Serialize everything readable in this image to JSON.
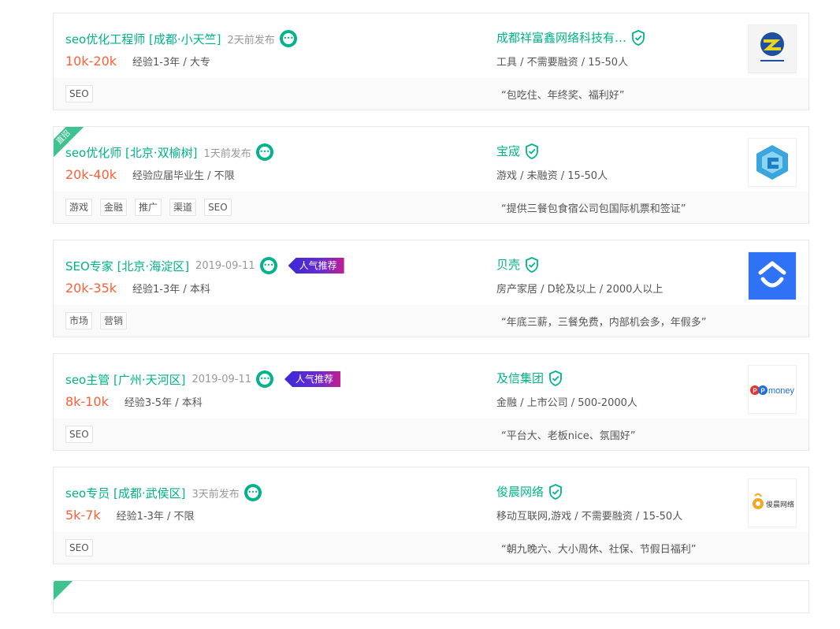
{
  "jobs": [
    {
      "position": "seo优化工程师 [成都·小天竺]",
      "published": "2天前发布",
      "salary": "10k-20k",
      "requirement": "经验1-3年 / 大专",
      "tags": [
        "SEO"
      ],
      "company": "成都祥富鑫网络科技有…",
      "industry": "工具 / 不需要融资 / 15-50人",
      "advantage": "“包吃住、年终奖、福利好”",
      "logo": "xiangfuxin-logo"
    },
    {
      "corner_flag": "直招",
      "position": "seo优化师 [北京·双榆树]",
      "published": "1天前发布",
      "salary": "20k-40k",
      "requirement": "经验应届毕业生 / 不限",
      "tags": [
        "游戏",
        "金融",
        "推广",
        "渠道",
        "SEO"
      ],
      "company": "宝宬",
      "industry": "游戏 / 未融资 / 15-50人",
      "advantage": "“提供三餐包食宿公司包国际机票和签证”",
      "logo": "baocheng-logo"
    },
    {
      "position": "SEO专家 [北京·海淀区]",
      "published": "2019-09-11",
      "hot_badge": "人气推荐",
      "salary": "20k-35k",
      "requirement": "经验1-3年 / 本科",
      "tags": [
        "市场",
        "营销"
      ],
      "company": "贝壳",
      "industry": "房产家居 / D轮及以上 / 2000人以上",
      "advantage": "“年底三薪，三餐免费，内部机会多，年假多”",
      "logo": "beike-logo"
    },
    {
      "position": "seo主管 [广州·天河区]",
      "published": "2019-09-11",
      "hot_badge": "人气推荐",
      "salary": "8k-10k",
      "requirement": "经验3-5年 / 本科",
      "tags": [
        "SEO"
      ],
      "company": "及信集团",
      "industry": "金融 / 上市公司 / 500-2000人",
      "advantage": "“平台大、老板nice、氛围好”",
      "logo": "ppmoney-logo",
      "logo_text": "money"
    },
    {
      "position": "seo专员 [成都·武侯区]",
      "published": "3天前发布",
      "salary": "5k-7k",
      "requirement": "经验1-3年 / 不限",
      "tags": [
        "SEO"
      ],
      "company": "俊晨网络",
      "industry": "移动互联网,游戏 / 不需要融资 / 15-50人",
      "advantage": "“朝九晚六、大小周休、社保、节假日福利”",
      "logo": "junchen-logo",
      "logo_text": "俊晨网络"
    }
  ],
  "colors": {
    "brand_green": "#00b38a",
    "salary_orange": "#fd5f39",
    "hot_badge_start": "#3a2ad6",
    "hot_badge_end": "#c41e8f"
  }
}
